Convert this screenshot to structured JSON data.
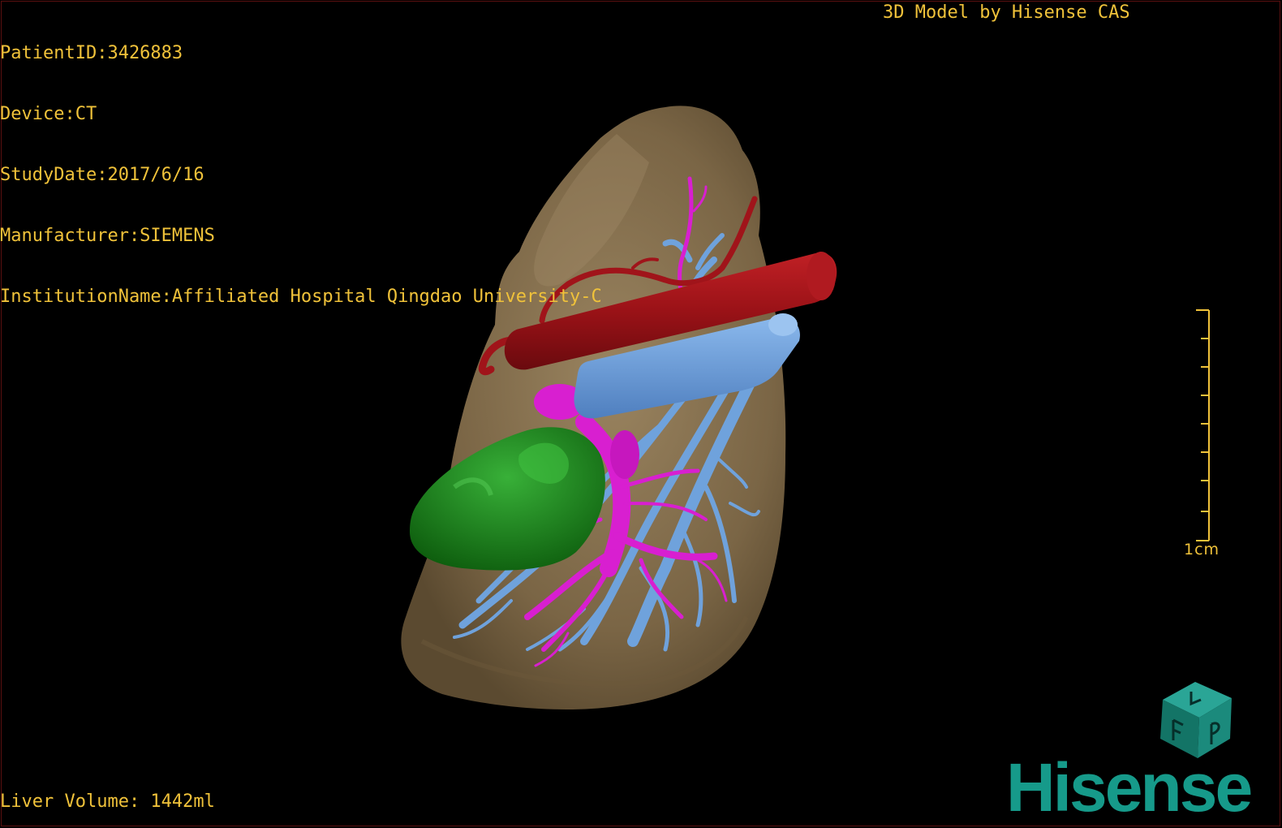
{
  "patient_info": {
    "patient_id": "PatientID:3426883",
    "device": "Device:CT",
    "study_date": "StudyDate:2017/6/16",
    "manufacturer": "Manufacturer:SIEMENS",
    "institution": "InstitutionName:Affiliated Hospital Qingdao University-C"
  },
  "credit": "3D Model by Hisense CAS",
  "liver_volume": "Liver Volume: 1442ml",
  "scale_bar": {
    "label": "1cm"
  },
  "logo": {
    "text": "Hisense"
  },
  "orientation_cube": {
    "face_letters": [
      "F",
      "L",
      "P"
    ]
  },
  "colors": {
    "overlay_text": "#f0c23a",
    "liver": "#8a7352",
    "hepatic_artery": "#a0141a",
    "portal_vein": "#d81fd0",
    "hepatic_vein": "#6fa2dc",
    "gallbladder_mass": "#1d8a1d",
    "brand": "#169a8a"
  },
  "icons": {
    "orientation": "orientation-cube-icon",
    "logo": "hisense-logo"
  }
}
